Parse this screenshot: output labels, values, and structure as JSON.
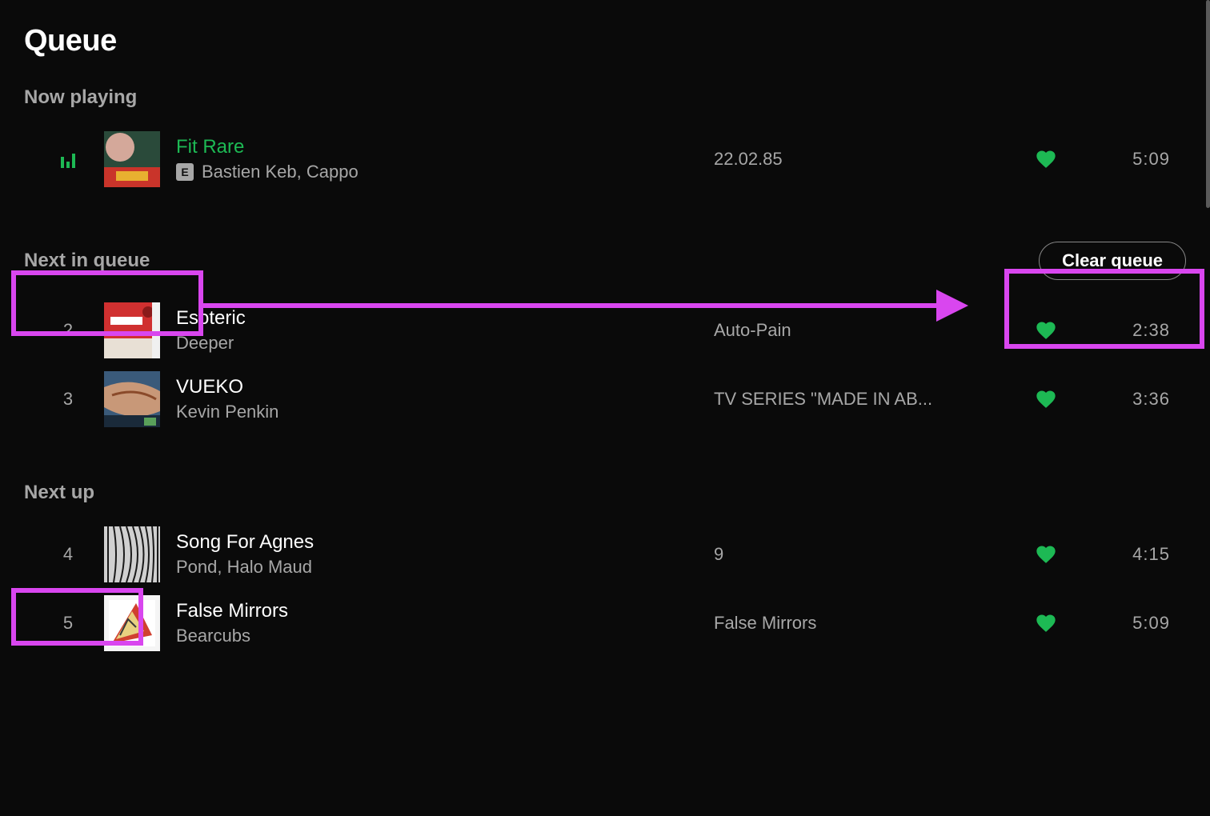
{
  "page_title": "Queue",
  "now_playing_label": "Now playing",
  "next_in_queue_label": "Next in queue",
  "next_up_label": "Next up",
  "clear_queue_label": "Clear queue",
  "explicit_badge": "E",
  "now_playing": {
    "title": "Fit Rare",
    "artist": "Bastien Keb, Cappo",
    "album": "22.02.85",
    "duration": "5:09",
    "explicit": true,
    "liked": true
  },
  "next_in_queue": [
    {
      "index": "2",
      "title": "Esoteric",
      "artist": "Deeper",
      "album": "Auto-Pain",
      "duration": "2:38",
      "liked": true
    },
    {
      "index": "3",
      "title": "VUEKO",
      "artist": "Kevin Penkin",
      "album": "TV SERIES \"MADE IN AB...",
      "duration": "3:36",
      "liked": true
    }
  ],
  "next_up": [
    {
      "index": "4",
      "title": "Song For Agnes",
      "artist": "Pond, Halo Maud",
      "album": "9",
      "duration": "4:15",
      "liked": true
    },
    {
      "index": "5",
      "title": "False Mirrors",
      "artist": "Bearcubs",
      "album": "False Mirrors",
      "duration": "5:09",
      "liked": true
    }
  ]
}
